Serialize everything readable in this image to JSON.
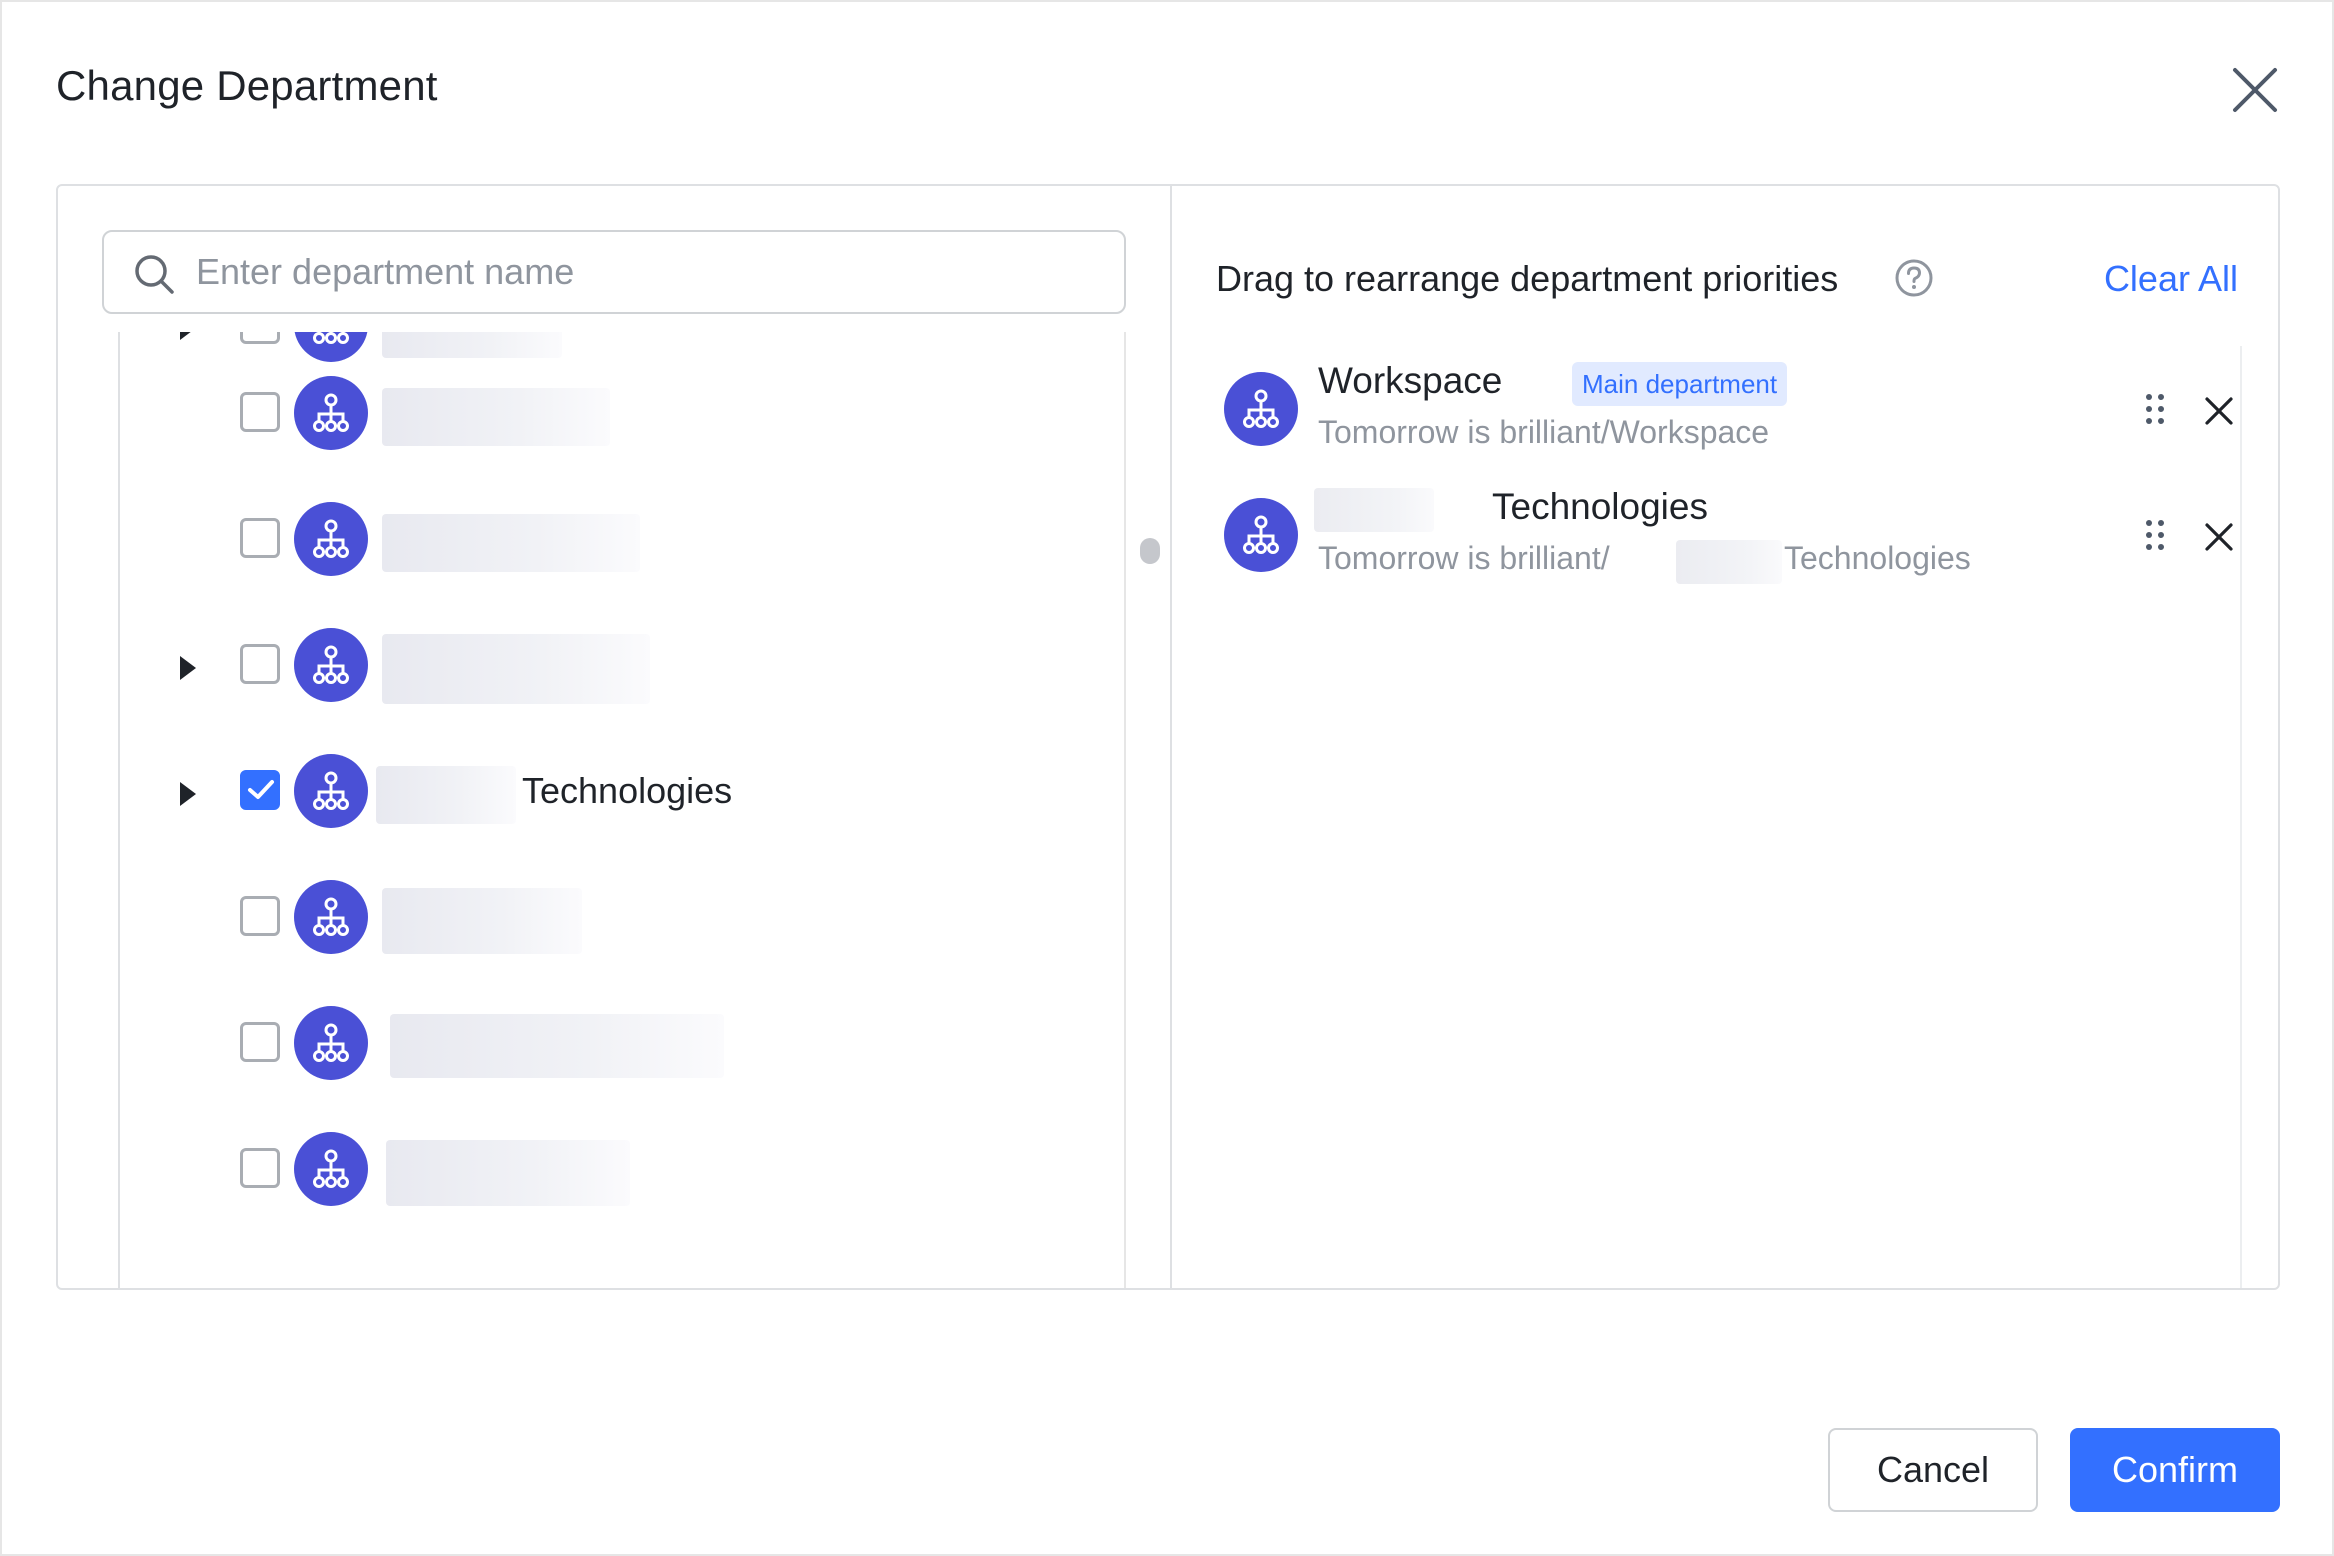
{
  "dialog": {
    "title": "Change Department",
    "close_icon": "close-icon"
  },
  "search": {
    "placeholder": "Enter department name",
    "icon": "search-icon"
  },
  "tree": {
    "rows": [
      {
        "expandable": true,
        "checked": false,
        "label": ""
      },
      {
        "expandable": false,
        "checked": false,
        "label": ""
      },
      {
        "expandable": false,
        "checked": false,
        "label": ""
      },
      {
        "expandable": true,
        "checked": false,
        "label": ""
      },
      {
        "expandable": true,
        "checked": true,
        "label": "Technologies"
      },
      {
        "expandable": false,
        "checked": false,
        "label": ""
      },
      {
        "expandable": false,
        "checked": false,
        "label": ""
      },
      {
        "expandable": false,
        "checked": false,
        "label": ""
      }
    ]
  },
  "selected": {
    "header": "Drag to rearrange department priorities",
    "help_icon": "question-circle-icon",
    "clear_all": "Clear All",
    "items": [
      {
        "name": "Workspace",
        "badge": "Main department",
        "path": "Tomorrow is brilliant/Workspace"
      },
      {
        "name": "Technologies",
        "badge": "",
        "path_prefix": "Tomorrow is brilliant/",
        "path_suffix": "Technologies"
      }
    ]
  },
  "footer": {
    "cancel": "Cancel",
    "confirm": "Confirm"
  },
  "colors": {
    "accent": "#3370ff",
    "avatar": "#4a50d6",
    "badge_bg": "#e1eaff",
    "muted_text": "#8f959e"
  }
}
